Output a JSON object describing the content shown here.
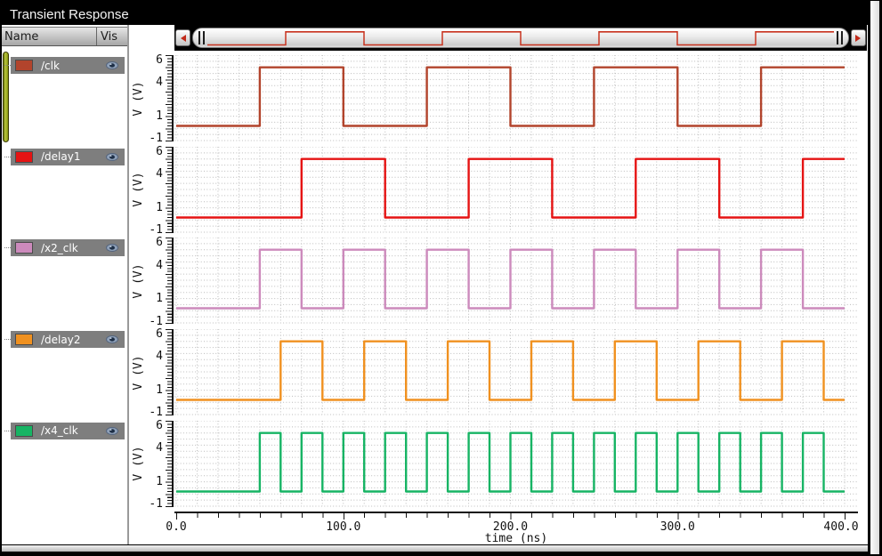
{
  "window": {
    "title": "Transient Response"
  },
  "sidebar": {
    "name_header": "Name",
    "vis_header": "Vis",
    "visibility_icon": "eye"
  },
  "scrollbar": {
    "left_arrow_icon": "red-left-triangle",
    "right_arrow_icon": "red-right-triangle",
    "preview_signal": "/clk",
    "preview_color": "#c8321e"
  },
  "chart_data": {
    "type": "line",
    "subtype": "digital-square-waves",
    "title": "Transient Response",
    "xlabel": "time (ns)",
    "ylabel": "V (V)",
    "xlim": [
      0,
      400
    ],
    "ylim": [
      -1,
      6
    ],
    "x_tick_values": [
      0,
      100,
      200,
      300,
      400
    ],
    "x_tick_labels": [
      "0.0",
      "100.0",
      "200.0",
      "300.0",
      "400.0"
    ],
    "x_minor_step_ns": 12.5,
    "y_tick_values": [
      6,
      4,
      1,
      -1
    ],
    "y_tick_labels": [
      "6",
      "4",
      "1",
      "-1"
    ],
    "grid": "dotted",
    "series": [
      {
        "name": "/clk",
        "color": "#b2442c",
        "low_v": 0.2,
        "high_v": 5.0,
        "first_rise_ns": 50,
        "high_width_ns": 50,
        "period_ns": 100
      },
      {
        "name": "/delay1",
        "color": "#e51313",
        "low_v": 0.2,
        "high_v": 5.0,
        "first_rise_ns": 75,
        "high_width_ns": 50,
        "period_ns": 100
      },
      {
        "name": "/x2_clk",
        "color": "#cc8abc",
        "low_v": 0.2,
        "high_v": 5.0,
        "first_rise_ns": 50,
        "high_width_ns": 25,
        "period_ns": 50
      },
      {
        "name": "/delay2",
        "color": "#f09120",
        "low_v": 0.2,
        "high_v": 5.0,
        "first_rise_ns": 62.5,
        "high_width_ns": 25,
        "period_ns": 50
      },
      {
        "name": "/x4_clk",
        "color": "#17b464",
        "low_v": 0.2,
        "high_v": 5.0,
        "first_rise_ns": 50,
        "high_width_ns": 12.5,
        "period_ns": 25
      }
    ]
  }
}
